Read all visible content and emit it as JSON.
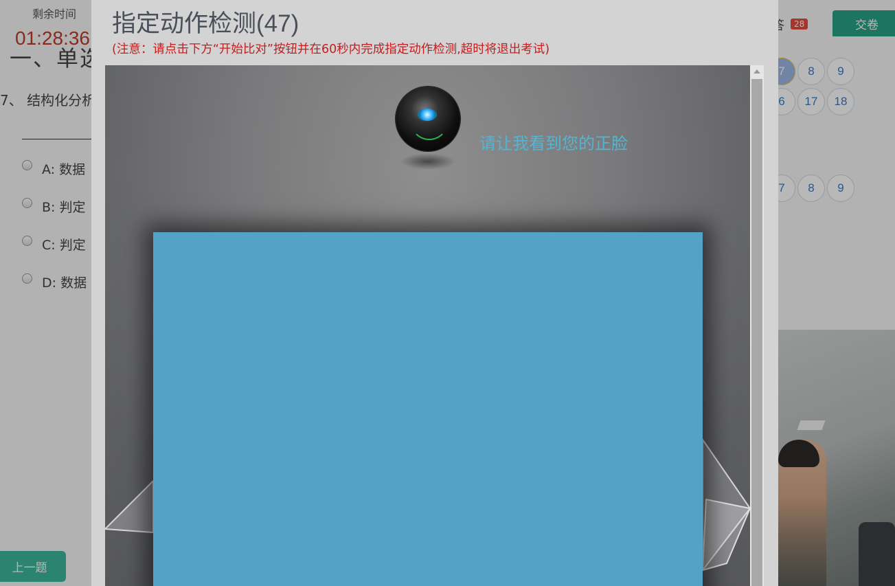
{
  "exam": {
    "time_label": "剩余时间",
    "time_value": "01:28:36",
    "section_title": "一、单选",
    "question_text": "7、 结构化分析",
    "options": [
      {
        "label": "A:  数据"
      },
      {
        "label": "B:  判定"
      },
      {
        "label": "C:  判定"
      },
      {
        "label": "D:  数据"
      }
    ],
    "prev_button": "上一题",
    "answered_label": "答",
    "answered_count": "28",
    "submit_button": "交卷",
    "question_numbers_row1": [
      "7",
      "8",
      "9"
    ],
    "question_numbers_row2": [
      "6",
      "17",
      "18"
    ],
    "question_numbers_row3": [
      "7",
      "8",
      "9"
    ]
  },
  "modal": {
    "title": "指定动作检测(47)",
    "notice": "(注意：请点击下方“开始比对”按钮并在60秒内完成指定动作检测,超时将退出考试)",
    "prompt": "请让我看到您的正脸"
  },
  "colors": {
    "notice_red": "#c51d1d",
    "prompt_blue": "#4fb6d6",
    "camera_panel": "#53a3c6",
    "accent_green": "#26a385"
  }
}
